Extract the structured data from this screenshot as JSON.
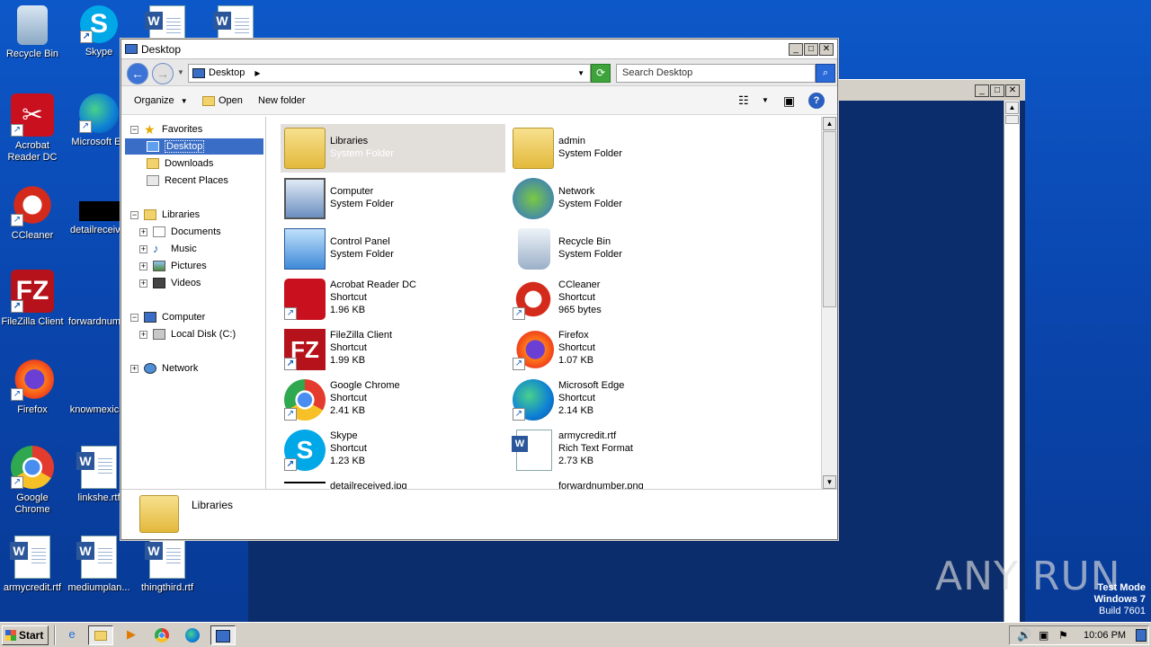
{
  "desktop": {
    "icons": [
      {
        "label": "Recycle Bin"
      },
      {
        "label": "Skype"
      },
      {
        "label": "Acrobat Reader DC"
      },
      {
        "label": "Microsoft Ed"
      },
      {
        "label": "CCleaner"
      },
      {
        "label": "detailreceiv"
      },
      {
        "label": "FileZilla Client"
      },
      {
        "label": "forwardnum"
      },
      {
        "label": "Firefox"
      },
      {
        "label": "knowmexic"
      },
      {
        "label": "Google Chrome"
      },
      {
        "label": "linkshe.rtf"
      },
      {
        "label": "armycredit.rtf"
      },
      {
        "label": "mediumplan..."
      },
      {
        "label": "thingthird.rtf"
      }
    ]
  },
  "explorer": {
    "title": "Desktop",
    "address": "Desktop",
    "search_placeholder": "Search Desktop",
    "toolbar": {
      "organize": "Organize",
      "open": "Open",
      "new_folder": "New folder"
    },
    "nav": {
      "favorites": "Favorites",
      "desktop": "Desktop",
      "downloads": "Downloads",
      "recent": "Recent Places",
      "libraries": "Libraries",
      "documents": "Documents",
      "music": "Music",
      "pictures": "Pictures",
      "videos": "Videos",
      "computer": "Computer",
      "localdisk": "Local Disk (C:)",
      "network": "Network"
    },
    "items": [
      {
        "name": "Libraries",
        "type": "System Folder",
        "size": ""
      },
      {
        "name": "admin",
        "type": "System Folder",
        "size": ""
      },
      {
        "name": "Computer",
        "type": "System Folder",
        "size": ""
      },
      {
        "name": "Network",
        "type": "System Folder",
        "size": ""
      },
      {
        "name": "Control Panel",
        "type": "System Folder",
        "size": ""
      },
      {
        "name": "Recycle Bin",
        "type": "System Folder",
        "size": ""
      },
      {
        "name": "Acrobat Reader DC",
        "type": "Shortcut",
        "size": "1.96 KB"
      },
      {
        "name": "CCleaner",
        "type": "Shortcut",
        "size": "965 bytes"
      },
      {
        "name": "FileZilla Client",
        "type": "Shortcut",
        "size": "1.99 KB"
      },
      {
        "name": "Firefox",
        "type": "Shortcut",
        "size": "1.07 KB"
      },
      {
        "name": "Google Chrome",
        "type": "Shortcut",
        "size": "2.41 KB"
      },
      {
        "name": "Microsoft Edge",
        "type": "Shortcut",
        "size": "2.14 KB"
      },
      {
        "name": "Skype",
        "type": "Shortcut",
        "size": "1.23 KB"
      },
      {
        "name": "armycredit.rtf",
        "type": "Rich Text Format",
        "size": "2.73 KB"
      },
      {
        "name": "detailreceived.jpg",
        "type": "",
        "size": ""
      },
      {
        "name": "forwardnumber.png",
        "type": "",
        "size": ""
      }
    ],
    "details_name": "Libraries"
  },
  "taskbar": {
    "start": "Start",
    "time": "10:06 PM"
  },
  "watermark": {
    "line1": "Test Mode",
    "line2": "Windows 7",
    "line3": "Build 7601",
    "brand": "ANY RUN"
  }
}
